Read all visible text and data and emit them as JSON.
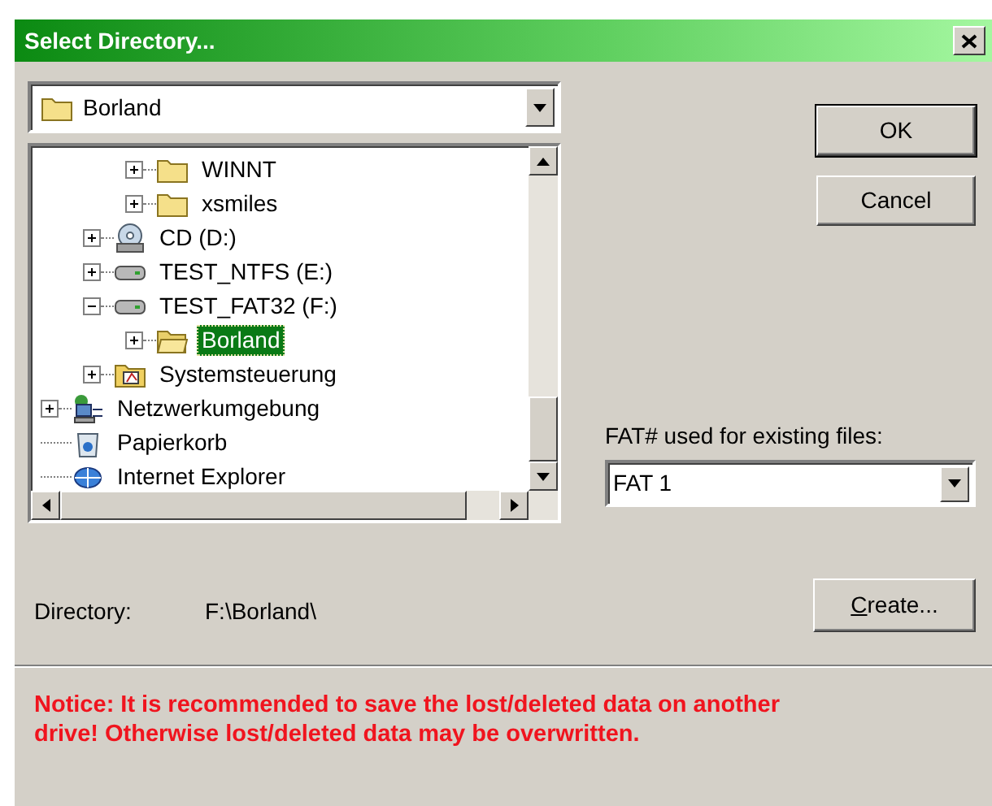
{
  "window": {
    "title": "Select Directory..."
  },
  "drive_combo": {
    "value": "Borland",
    "kind": "folder"
  },
  "tree": {
    "items": [
      {
        "children": [
          {
            "children": [
              {
                "label": "WINNT",
                "kind": "folder",
                "expanded": false,
                "selected": false
              },
              {
                "label": "xsmiles",
                "kind": "folder",
                "expanded": false,
                "selected": false
              }
            ]
          },
          {
            "label": "CD (D:)",
            "kind": "cd",
            "expanded": false,
            "selected": false
          },
          {
            "label": "TEST_NTFS (E:)",
            "kind": "drive",
            "expanded": false,
            "selected": false
          },
          {
            "label": "TEST_FAT32 (F:)",
            "kind": "drive",
            "expanded": true,
            "selected": false,
            "children": [
              {
                "label": "Borland",
                "kind": "folder-open",
                "expanded": false,
                "selected": true
              }
            ]
          },
          {
            "label": "Systemsteuerung",
            "kind": "control-panel",
            "expanded": false,
            "selected": false
          }
        ]
      },
      {
        "label": "Netzwerkumgebung",
        "kind": "network",
        "expanded": false,
        "selected": false
      },
      {
        "label": "Papierkorb",
        "kind": "recycle-bin",
        "selected": false
      },
      {
        "label": "Internet Explorer",
        "kind": "globe",
        "selected": false
      }
    ]
  },
  "buttons": [
    {
      "label": "OK",
      "default": true
    },
    {
      "label": "Cancel",
      "default": false
    }
  ],
  "fat_field": {
    "label": "FAT# used for existing files:",
    "value": "FAT 1"
  },
  "directory": {
    "label": "Directory:",
    "value": "F:\\Borland\\"
  },
  "create_button": {
    "label": "Create...",
    "access_key_underlined": true
  },
  "notice": "Notice: It is recommended to save the lost/deleted data on another drive! Otherwise lost/deleted data may be overwritten."
}
